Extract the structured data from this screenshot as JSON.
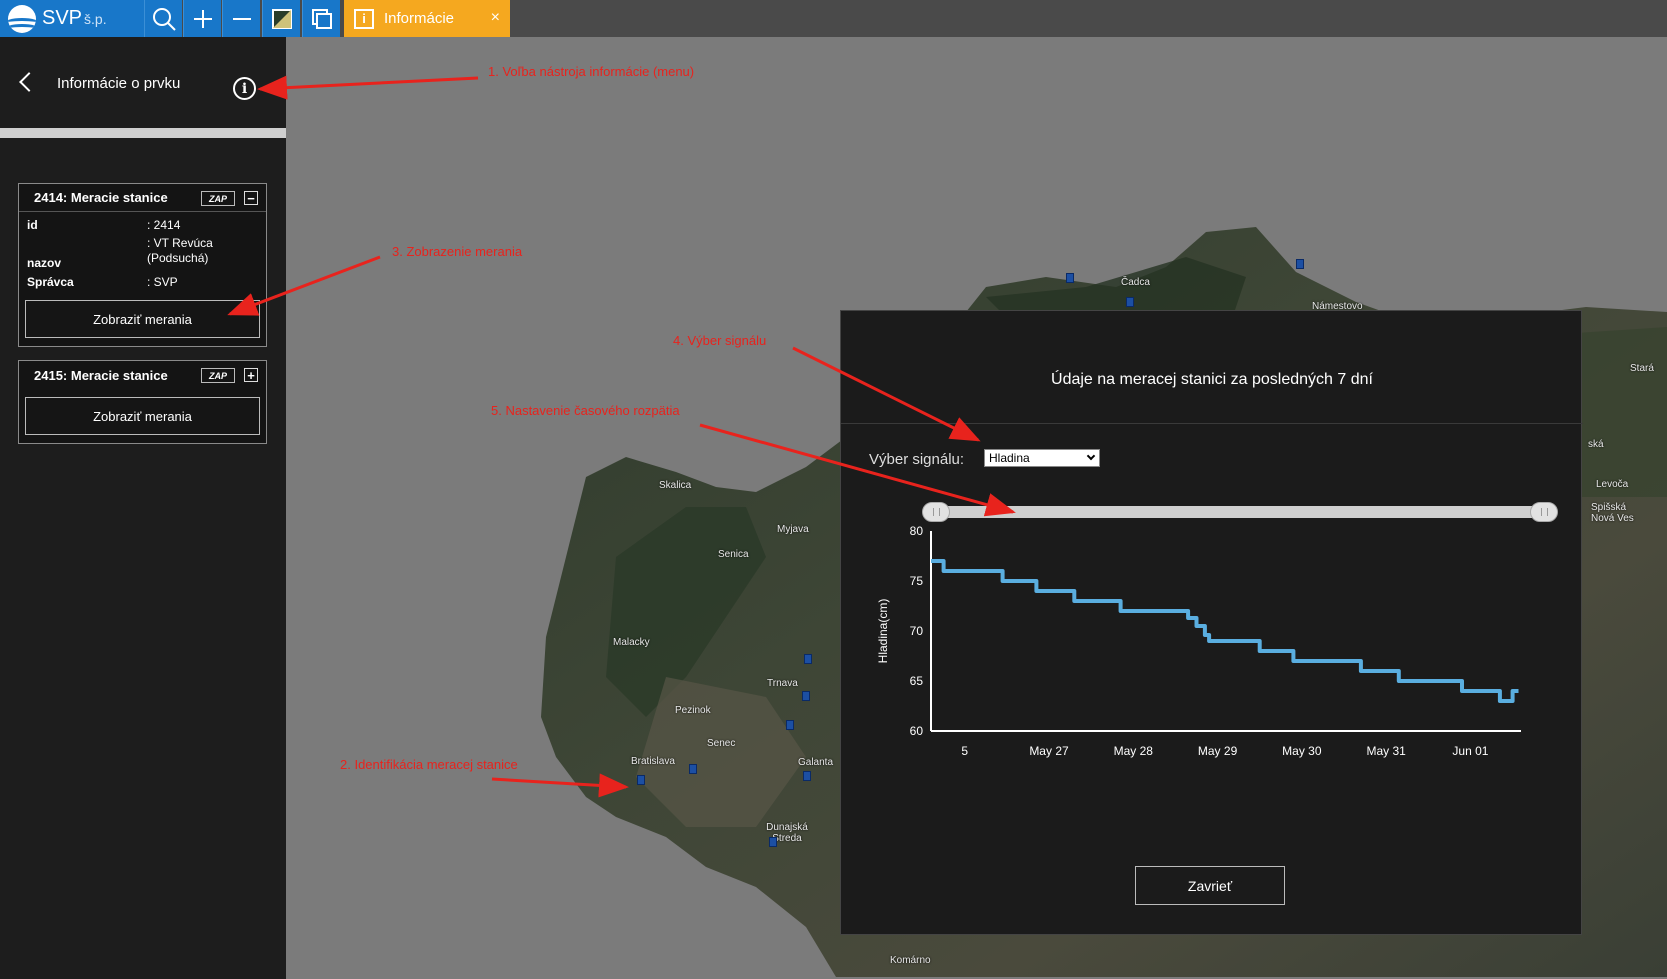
{
  "toolbar": {
    "logo_text": "SVP",
    "logo_suffix": "š.p.",
    "tools": [
      "search-icon",
      "zoom-in-icon",
      "zoom-out-icon",
      "basemap-icon",
      "layers-icon"
    ],
    "active_tab_label": "Informácie",
    "active_tab_icon": "info-icon",
    "close_glyph": "×"
  },
  "sidebar": {
    "title": "Informácie o prvku",
    "info_glyph": "i",
    "cards": [
      {
        "title": "2414: Meracie stanice",
        "zap": "ZAP",
        "toggle": "−",
        "attributes": [
          {
            "key": "id",
            "value": ": 2414"
          },
          {
            "key": "nazov",
            "value": ": VT Revúca (Podsuchá)"
          },
          {
            "key": "Správca",
            "value": ": SVP"
          }
        ],
        "button": "Zobraziť merania"
      },
      {
        "title": "2415: Meracie stanice",
        "zap": "ZAP",
        "toggle": "+",
        "button": "Zobraziť merania"
      }
    ]
  },
  "map": {
    "labels": [
      "Skalica",
      "Myjava",
      "Senica",
      "Malacky",
      "Trnava",
      "Pezinok",
      "Senec",
      "Bratislava",
      "Galanta",
      "Dunajská Streda",
      "Komárno",
      "Čadca",
      "Námestovo",
      "Stará",
      "Levoča",
      "Spišská Nová Ves",
      "ská"
    ]
  },
  "dialog": {
    "title": "Údaje na meracej stanici za posledných 7 dní",
    "signal_label": "Výber signálu:",
    "signal_selected": "Hladina",
    "slider_range": [
      0,
      1
    ],
    "close_label": "Zavrieť"
  },
  "chart_data": {
    "type": "line",
    "ylabel": "Hladina(cm)",
    "xlabel": "",
    "ylim": [
      60,
      80
    ],
    "yticks": [
      60,
      65,
      70,
      75,
      80
    ],
    "xticks": [
      "5",
      "May 27",
      "May 28",
      "May 29",
      "May 30",
      "May 31",
      "Jun 01"
    ],
    "xlim": [
      0,
      7
    ],
    "series": [
      {
        "color": "#5aaee0",
        "points": [
          [
            0.0,
            77
          ],
          [
            0.15,
            77
          ],
          [
            0.15,
            76
          ],
          [
            0.85,
            76
          ],
          [
            0.85,
            75
          ],
          [
            1.25,
            75
          ],
          [
            1.25,
            74
          ],
          [
            1.7,
            74
          ],
          [
            1.7,
            73
          ],
          [
            2.25,
            73
          ],
          [
            2.25,
            72
          ],
          [
            2.45,
            72
          ],
          [
            2.45,
            72
          ],
          [
            3.05,
            72
          ],
          [
            3.05,
            71.3
          ],
          [
            3.15,
            71.3
          ],
          [
            3.15,
            70.5
          ],
          [
            3.25,
            70.5
          ],
          [
            3.25,
            69.6
          ],
          [
            3.3,
            69.6
          ],
          [
            3.3,
            69
          ],
          [
            3.5,
            69
          ],
          [
            3.9,
            69
          ],
          [
            3.9,
            68
          ],
          [
            4.3,
            68
          ],
          [
            4.3,
            67
          ],
          [
            5.1,
            67
          ],
          [
            5.1,
            66
          ],
          [
            5.55,
            66
          ],
          [
            5.55,
            65
          ],
          [
            6.3,
            65
          ],
          [
            6.3,
            64
          ],
          [
            6.75,
            64
          ],
          [
            6.75,
            63
          ],
          [
            6.9,
            63
          ],
          [
            6.9,
            64
          ],
          [
            6.97,
            64
          ]
        ]
      }
    ]
  },
  "annotations": [
    {
      "text": "1. Voľba nástroja informácie (menu)"
    },
    {
      "text": "2. Identifikácia meracej stanice"
    },
    {
      "text": "3. Zobrazenie merania"
    },
    {
      "text": "4. Výber signálu"
    },
    {
      "text": "5. Nastavenie časového rozpätia"
    }
  ]
}
